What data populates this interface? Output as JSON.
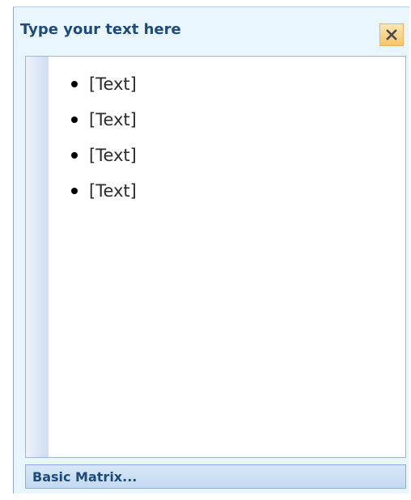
{
  "panel": {
    "title": "Type your text here",
    "close_icon": "close-icon",
    "accent_color": "#1f4a7a"
  },
  "editor": {
    "bullet_items": [
      {
        "text": "[Text]"
      },
      {
        "text": "[Text]"
      },
      {
        "text": "[Text]"
      },
      {
        "text": "[Text]"
      }
    ]
  },
  "footer": {
    "link_label": "Basic Matrix..."
  }
}
